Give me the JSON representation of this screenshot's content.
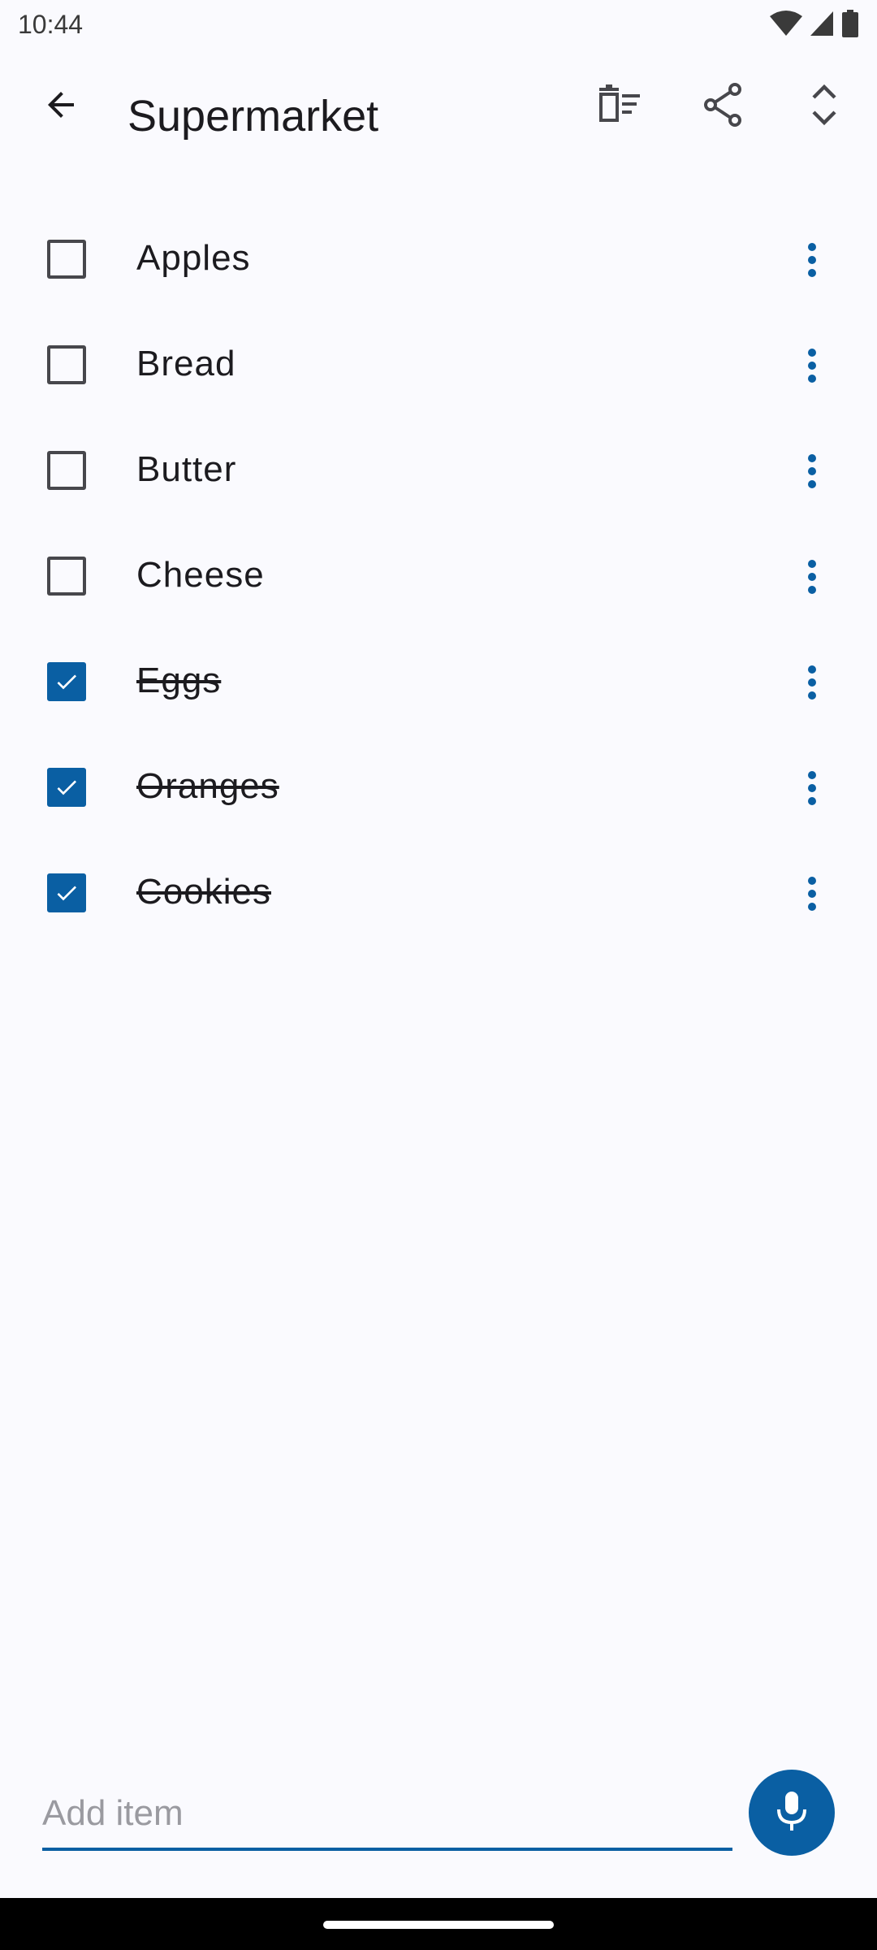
{
  "status_bar": {
    "time": "10:44",
    "icons": [
      "wifi-icon",
      "cellular-icon",
      "battery-icon"
    ]
  },
  "app_bar": {
    "title": "Supermarket",
    "actions": [
      "back-arrow-icon",
      "clear-checked-icon",
      "share-icon",
      "expand-collapse-icon"
    ]
  },
  "items": [
    {
      "label": "Apples",
      "checked": false
    },
    {
      "label": "Bread",
      "checked": false
    },
    {
      "label": "Butter",
      "checked": false
    },
    {
      "label": "Cheese",
      "checked": false
    },
    {
      "label": "Eggs",
      "checked": true
    },
    {
      "label": "Oranges ",
      "checked": true
    },
    {
      "label": "Cookies",
      "checked": true
    }
  ],
  "add_item": {
    "placeholder": "Add item",
    "value": ""
  },
  "colors": {
    "accent": "#0a5fa3",
    "background": "#fafafe",
    "text": "#1c1b1f"
  }
}
